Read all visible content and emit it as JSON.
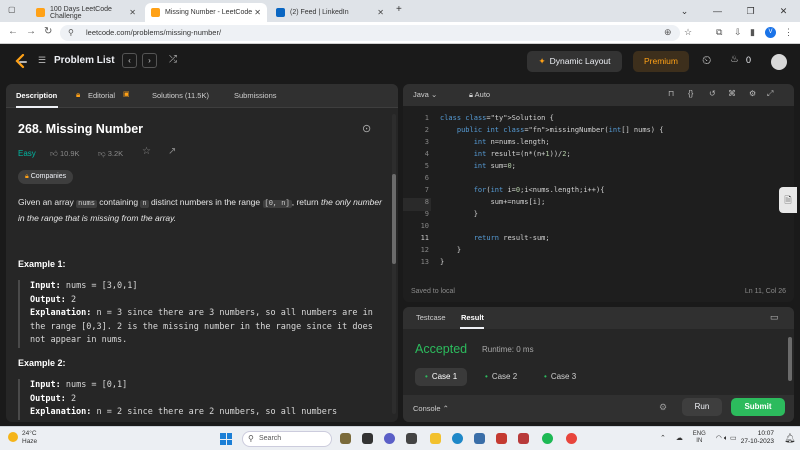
{
  "browser": {
    "tabs": [
      {
        "title": "100 Days LeetCode Challenge",
        "active": false,
        "color": "#ffa116"
      },
      {
        "title": "Missing Number - LeetCode",
        "active": true,
        "color": "#ffa116"
      },
      {
        "title": "(2) Feed | LinkedIn",
        "active": false,
        "color": "#0a66c2"
      }
    ],
    "url": "leetcode.com/problems/missing-number/",
    "profile_letter": "V"
  },
  "header": {
    "problem_list": "Problem List",
    "dynamic_layout": "Dynamic Layout",
    "premium": "Premium",
    "streak": "0"
  },
  "left_tabs": [
    {
      "label": "Description",
      "active": true
    },
    {
      "label": "Editorial",
      "active": false
    },
    {
      "label": "Solutions (11.5K)",
      "active": false
    },
    {
      "label": "Submissions",
      "active": false
    }
  ],
  "problem": {
    "title": "268. Missing Number",
    "difficulty": "Easy",
    "likes": "10.9K",
    "dislikes": "3.2K",
    "companies": "Companies",
    "desc_1": "Given an array ",
    "desc_nums": "nums",
    "desc_2": " containing ",
    "desc_n": "n",
    "desc_3": " distinct numbers in the range ",
    "desc_range": "[0, n]",
    "desc_4": ", return ",
    "desc_5": "the only number in the range that is missing from the array.",
    "examples": [
      {
        "heading": "Example 1:",
        "input_label": "Input:",
        "input": " nums = [3,0,1]",
        "output_label": "Output:",
        "output": " 2",
        "expl_label": "Explanation:",
        "expl": " n = 3 since there are 3 numbers, so all numbers are in the range [0,3]. 2 is the missing number in the range since it does not appear in nums."
      },
      {
        "heading": "Example 2:",
        "input_label": "Input:",
        "input": " nums = [0,1]",
        "output_label": "Output:",
        "output": " 2",
        "expl_label": "Explanation:",
        "expl": " n = 2 since there are 2 numbers, so all numbers"
      }
    ]
  },
  "editor": {
    "language": "Java",
    "mode": "Auto",
    "lines": [
      "class Solution {",
      "    public int missingNumber(int[] nums) {",
      "        int n=nums.length;",
      "        int result=(n*(n+1))/2;",
      "        int sum=0;",
      "",
      "        for(int i=0;i<nums.length;i++){",
      "            sum+=nums[i];",
      "        }",
      "",
      "        return result-sum;",
      "    }",
      "}"
    ],
    "saved": "Saved to local",
    "cursor": "Ln 11, Col 26"
  },
  "result": {
    "tabs": [
      {
        "label": "Testcase",
        "active": false
      },
      {
        "label": "Result",
        "active": true
      }
    ],
    "status": "Accepted",
    "runtime": "Runtime: 0 ms",
    "cases": [
      {
        "label": "Case 1",
        "active": true
      },
      {
        "label": "Case 2",
        "active": false
      },
      {
        "label": "Case 3",
        "active": false
      }
    ],
    "console": "Console",
    "run": "Run",
    "submit": "Submit"
  },
  "taskbar": {
    "temp": "24°C",
    "weather": "Haze",
    "search": "Search",
    "lang": "ENG",
    "region": "IN",
    "time": "10:07",
    "date": "27-10-2023"
  },
  "colors": {
    "accent": "#ffa116",
    "easy": "#00b8a3",
    "accepted": "#2cbb5d"
  }
}
